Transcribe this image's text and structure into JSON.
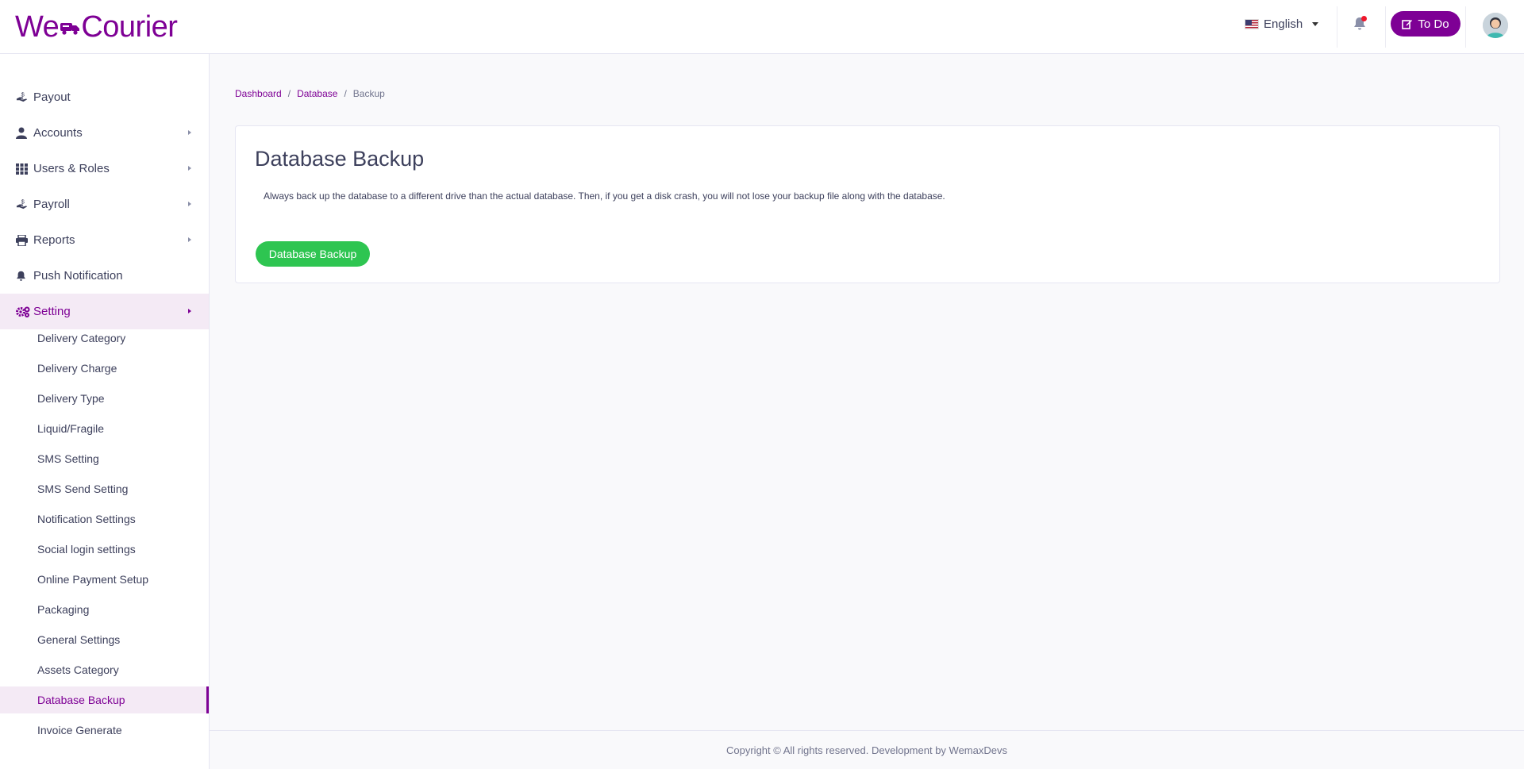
{
  "header": {
    "logo_left": "We",
    "logo_right": "Courier",
    "language": "English",
    "todo_label": "To Do"
  },
  "sidebar": {
    "items": [
      {
        "label": "Payout",
        "icon": "hand-coin-icon",
        "has_arrow": false
      },
      {
        "label": "Accounts",
        "icon": "user-icon",
        "has_arrow": true
      },
      {
        "label": "Users & Roles",
        "icon": "grid-icon",
        "has_arrow": true
      },
      {
        "label": "Payroll",
        "icon": "hand-coin-icon",
        "has_arrow": true
      },
      {
        "label": "Reports",
        "icon": "printer-icon",
        "has_arrow": true
      },
      {
        "label": "Push Notification",
        "icon": "bell-icon",
        "has_arrow": false
      },
      {
        "label": "Setting",
        "icon": "gears-icon",
        "has_arrow": true,
        "active": true
      }
    ],
    "sub_items": [
      "Delivery Category",
      "Delivery Charge",
      "Delivery Type",
      "Liquid/Fragile",
      "SMS Setting",
      "SMS Send Setting",
      "Notification Settings",
      "Social login settings",
      "Online Payment Setup",
      "Packaging",
      "General Settings",
      "Assets Category",
      "Database Backup",
      "Invoice Generate"
    ],
    "active_sub_item": "Database Backup"
  },
  "breadcrumb": {
    "items": [
      "Dashboard",
      "Database"
    ],
    "current": "Backup"
  },
  "card": {
    "title": "Database Backup",
    "description": "Always back up the database to a different drive than the actual database. Then, if you get a disk crash, you will not lose your backup file along with the database.",
    "button_label": "Database Backup"
  },
  "footer": {
    "text": "Copyright © All rights reserved. Development by WemaxDevs"
  },
  "colors": {
    "brand": "#7e0095",
    "success": "#2ec551",
    "active_bg": "#f4eaf5"
  }
}
